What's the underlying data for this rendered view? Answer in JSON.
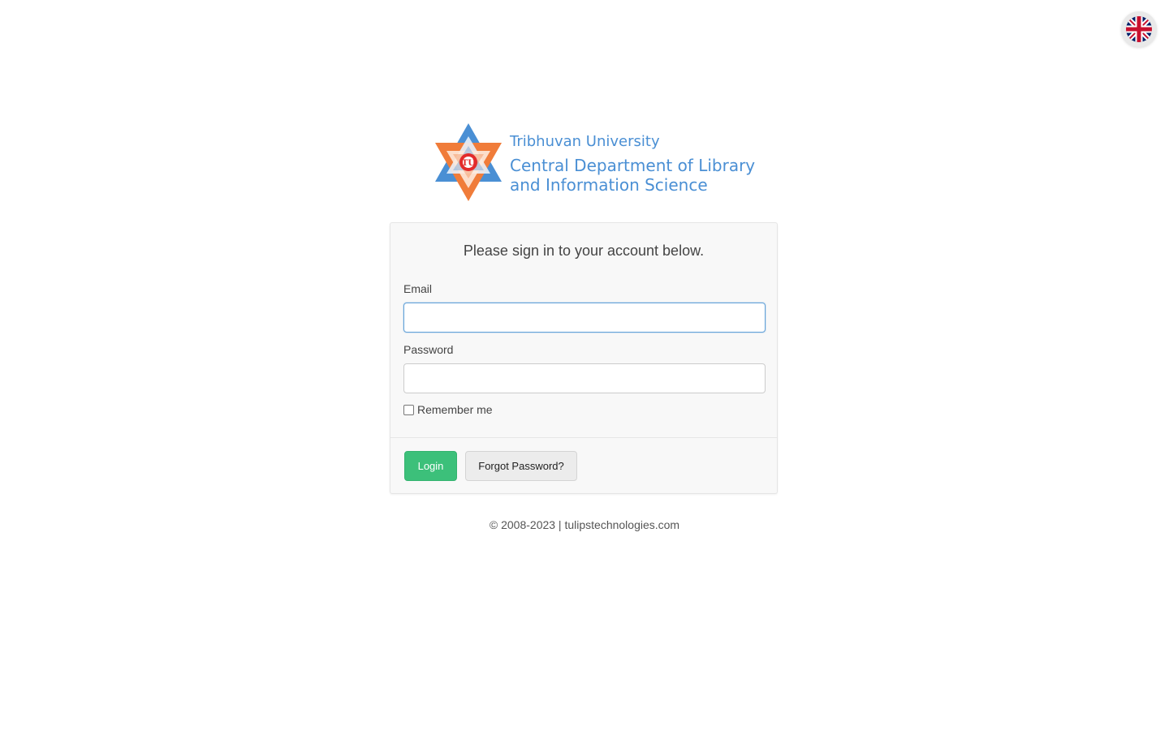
{
  "language": {
    "current": "English",
    "icon": "uk-flag-icon"
  },
  "logo": {
    "line1": "Tribhuvan University",
    "line2": "Central Department of Library",
    "line3": "and Information Science",
    "emblem_initials": "TU",
    "icon": "tribhuvan-university-emblem",
    "colors": {
      "orange": "#f07c3a",
      "blue": "#4a8fd4",
      "red": "#e32b2b"
    }
  },
  "login": {
    "title": "Please sign in to your account below.",
    "email_label": "Email",
    "email_value": "",
    "password_label": "Password",
    "password_value": "",
    "remember_label": "Remember me",
    "remember_checked": false,
    "login_button": "Login",
    "forgot_button": "Forgot Password?",
    "colors": {
      "login": "#3cc07a",
      "focus_border": "#66a3d9"
    }
  },
  "footer": {
    "text": "© 2008-2023 | tulipstechnologies.com"
  }
}
